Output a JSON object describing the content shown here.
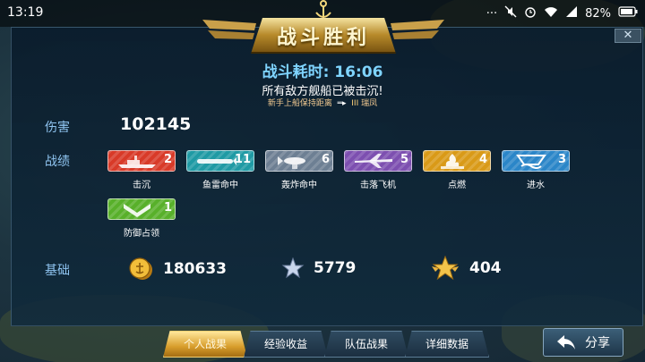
{
  "status_bar": {
    "time": "13:19",
    "battery": "82%"
  },
  "header": {
    "title": "战斗胜利",
    "close_label": "✕"
  },
  "summary": {
    "elapsed": "战斗耗时: 16:06",
    "result": "所有敌方舰船已被击沉!",
    "hint_left": "新手上船保持距离",
    "hint_mark": "III",
    "hint_right": "瑞凤"
  },
  "stats": {
    "damage_label": "伤害",
    "damage_value": "102145",
    "record_label": "战绩",
    "medals": [
      {
        "name": "击沉",
        "count": "2",
        "color": "#d83a28",
        "icon": "battleship-icon"
      },
      {
        "name": "鱼雷命中",
        "count": "11",
        "color": "#1f9aa4",
        "icon": "torpedo-icon"
      },
      {
        "name": "轰炸命中",
        "count": "6",
        "color": "#6d7f93",
        "icon": "bomb-icon"
      },
      {
        "name": "击落飞机",
        "count": "5",
        "color": "#7d4fb0",
        "icon": "plane-icon"
      },
      {
        "name": "点燃",
        "count": "4",
        "color": "#d99a18",
        "icon": "fire-icon"
      },
      {
        "name": "进水",
        "count": "3",
        "color": "#2b86c8",
        "icon": "flood-icon"
      },
      {
        "name": "防御占领",
        "count": "1",
        "color": "#58b02a",
        "icon": "defense-chevron-icon"
      }
    ],
    "base_label": "基础",
    "base": {
      "coins": "180633",
      "experience": "5779",
      "captain_exp": "404"
    }
  },
  "tabs": [
    {
      "label": "个人战果",
      "active": true
    },
    {
      "label": "经验收益",
      "active": false
    },
    {
      "label": "队伍战果",
      "active": false
    },
    {
      "label": "详细数据",
      "active": false
    }
  ],
  "share_label": "分享"
}
